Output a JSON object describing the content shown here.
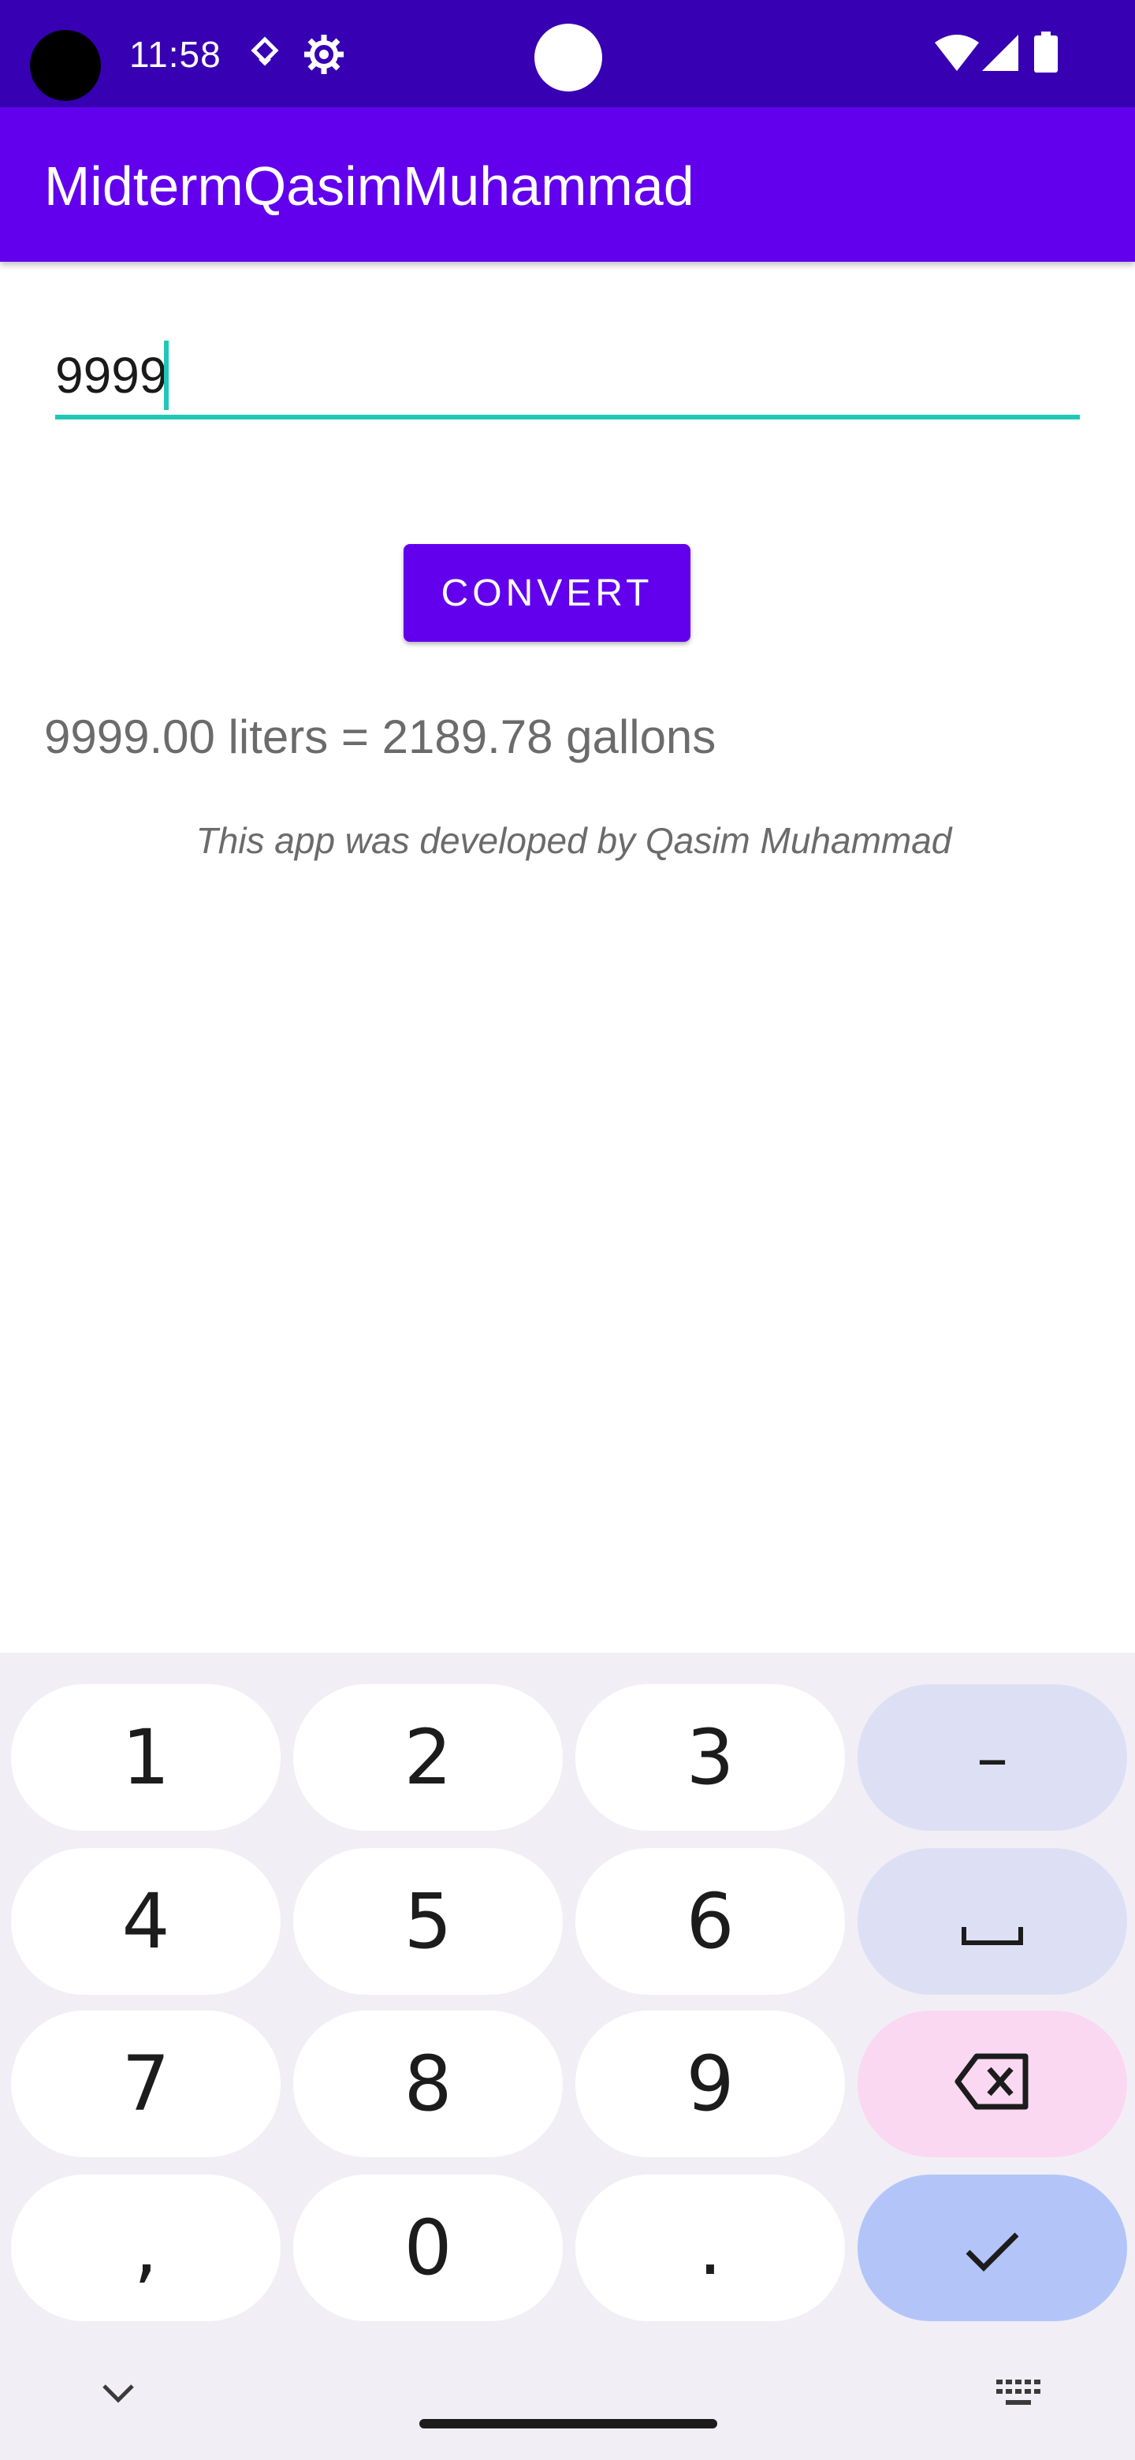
{
  "status_bar": {
    "time": "11:58",
    "icons": [
      "navigation-icon",
      "settings-icon",
      "wifi-icon",
      "signal-icon",
      "battery-icon"
    ],
    "background": "#3700B3"
  },
  "app_bar": {
    "title": "MidtermQasimMuhammad",
    "background": "#6200EE"
  },
  "input": {
    "value": "9999",
    "accent": "#1EC8B7"
  },
  "convert_button": {
    "label": "CONVERT"
  },
  "result": {
    "text": "9999.00 liters = 2189.78 gallons"
  },
  "credit": {
    "text": "This app was developed by Qasim Muhammad"
  },
  "keyboard": {
    "rows": [
      [
        "1",
        "2",
        "3",
        "–"
      ],
      [
        "4",
        "5",
        "6",
        "space"
      ],
      [
        "7",
        "8",
        "9",
        "backspace"
      ],
      [
        ",",
        "0",
        ".",
        "enter"
      ]
    ],
    "keys": {
      "k1": "1",
      "k2": "2",
      "k3": "3",
      "kdash": "–",
      "k4": "4",
      "k5": "5",
      "k6": "6",
      "k7": "7",
      "k8": "8",
      "k9": "9",
      "kcomma": ",",
      "k0": "0",
      "kdot": "."
    },
    "icons": [
      "space-icon",
      "backspace-icon",
      "check-icon",
      "chevron-down-icon",
      "keyboard-icon"
    ]
  }
}
